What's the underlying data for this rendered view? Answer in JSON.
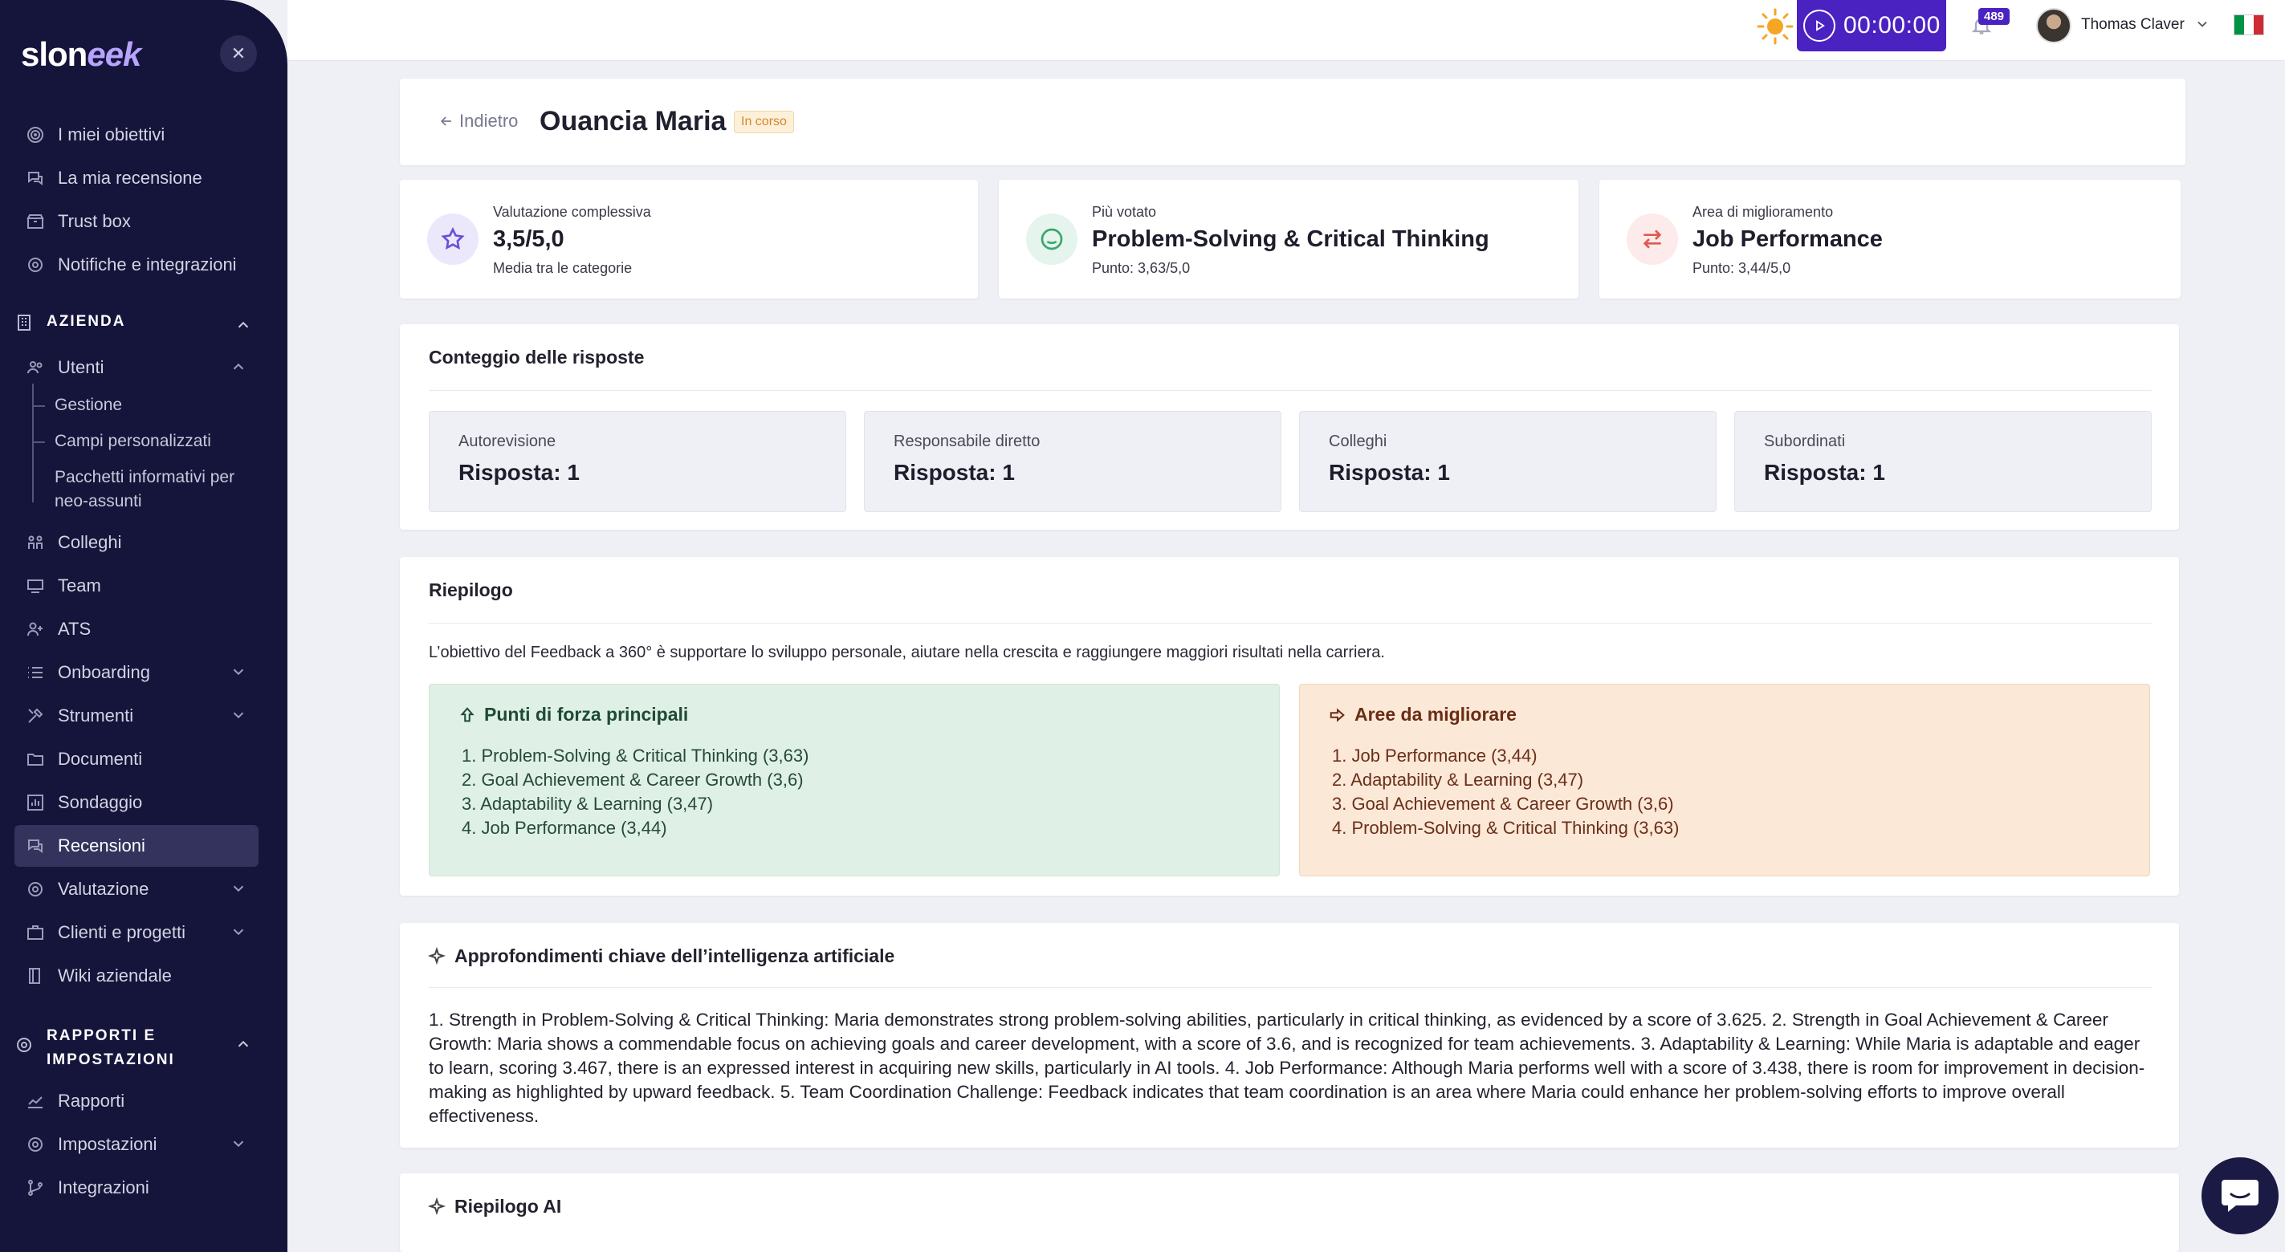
{
  "brand": {
    "logo_prefix": "slon",
    "logo_accent": "eek"
  },
  "sidebar": {
    "items": [
      {
        "label": "I miei obiettivi",
        "icon": "target-icon"
      },
      {
        "label": "La mia recensione",
        "icon": "chat-icon"
      },
      {
        "label": "Trust box",
        "icon": "box-icon"
      },
      {
        "label": "Notifiche e integrazioni",
        "icon": "gear-icon"
      }
    ],
    "section_company": "AZIENDA",
    "users": "Utenti",
    "users_sub": [
      "Gestione",
      "Campi personalizzati",
      "Pacchetti informativi per",
      "neo-assunti"
    ],
    "company_items": [
      {
        "label": "Colleghi"
      },
      {
        "label": "Team"
      },
      {
        "label": "ATS"
      },
      {
        "label": "Onboarding"
      },
      {
        "label": "Strumenti"
      },
      {
        "label": "Documenti"
      },
      {
        "label": "Sondaggio"
      },
      {
        "label": "Recensioni"
      },
      {
        "label": "Valutazione"
      },
      {
        "label": "Clienti e progetti"
      },
      {
        "label": "Wiki aziendale"
      }
    ],
    "section_reports_1": "RAPPORTI E",
    "section_reports_2": "IMPOSTAZIONI",
    "report_items": [
      {
        "label": "Rapporti"
      },
      {
        "label": "Impostazioni"
      },
      {
        "label": "Integrazioni"
      }
    ]
  },
  "topbar": {
    "timer": "00:00:00",
    "notifications": "489",
    "user_name": "Thomas Claver",
    "flag_colors": [
      "#009246",
      "#ffffff",
      "#ce2b37"
    ]
  },
  "header": {
    "back_label": "Indietro",
    "title": "Ouancia Maria",
    "status": "In corso"
  },
  "stats": [
    {
      "label": "Valutazione complessiva",
      "value": "3,5/5,0",
      "sub": "Media tra le categorie"
    },
    {
      "label": "Più votato",
      "value": "Problem-Solving & Critical Thinking",
      "sub": "Punto: 3,63/5,0"
    },
    {
      "label": "Area di miglioramento",
      "value": "Job Performance",
      "sub": "Punto: 3,44/5,0"
    }
  ],
  "responses": {
    "title": "Conteggio delle risposte",
    "items": [
      {
        "label": "Autorevisione",
        "value": "Risposta: 1"
      },
      {
        "label": "Responsabile diretto",
        "value": "Risposta: 1"
      },
      {
        "label": "Colleghi",
        "value": "Risposta: 1"
      },
      {
        "label": "Subordinati",
        "value": "Risposta: 1"
      }
    ]
  },
  "summary": {
    "title": "Riepilogo",
    "intro": "L’obiettivo del Feedback a 360° è supportare lo sviluppo personale, aiutare nella crescita e raggiungere maggiori risultati nella carriera.",
    "strengths_title": "Punti di forza principali",
    "strengths": [
      "1. Problem-Solving & Critical Thinking (3,63)",
      "2. Goal Achievement & Career Growth (3,6)",
      "3. Adaptability & Learning (3,47)",
      "4. Job Performance (3,44)"
    ],
    "improve_title": "Aree da migliorare",
    "improve": [
      "1. Job Performance (3,44)",
      "2. Adaptability & Learning (3,47)",
      "3. Goal Achievement & Career Growth (3,6)",
      "4. Problem-Solving & Critical Thinking (3,63)"
    ]
  },
  "ai": {
    "title": "Approfondimenti chiave dell’intelligenza artificiale",
    "text": "1. Strength in Problem-Solving & Critical Thinking: Maria demonstrates strong problem-solving abilities, particularly in critical thinking, as evidenced by a score of 3.625. 2. Strength in Goal Achievement & Career Growth: Maria shows a commendable focus on achieving goals and career development, with a score of 3.6, and is recognized for team achievements. 3. Adaptability & Learning: While Maria is adaptable and eager to learn, scoring 3.467, there is an expressed interest in acquiring new skills, particularly in AI tools. 4. Job Performance: Although Maria performs well with a score of 3.438, there is room for improvement in decision-making as highlighted by upward feedback. 5. Team Coordination Challenge: Feedback indicates that team coordination is an area where Maria could enhance her problem-solving efforts to improve overall effectiveness.",
    "summary_title": "Riepilogo AI"
  }
}
